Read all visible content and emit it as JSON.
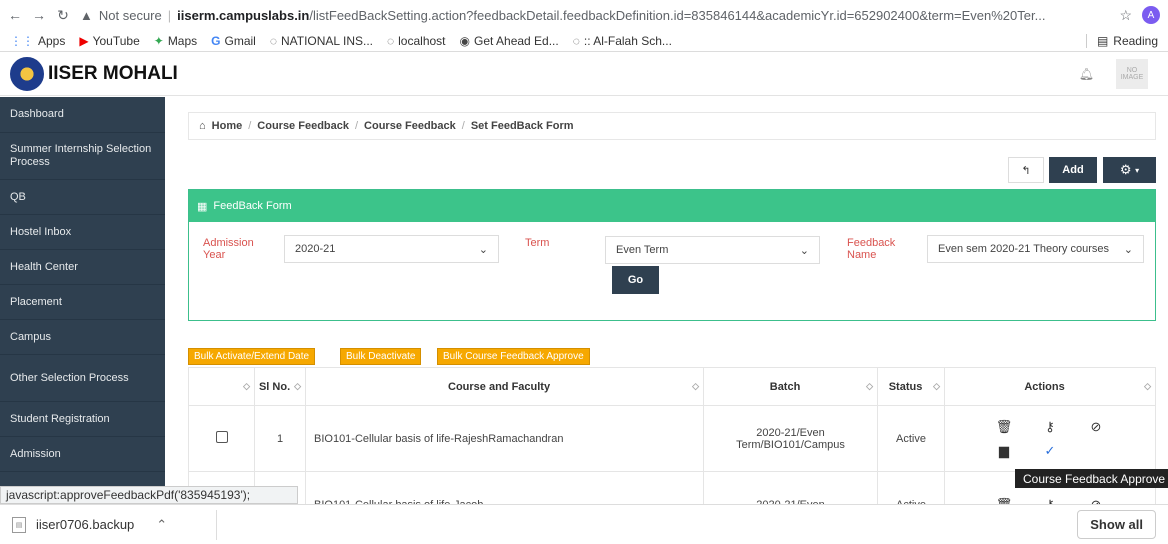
{
  "browser": {
    "security": "Not secure",
    "host": "iiserm.campuslabs.in",
    "path": "/listFeedBackSetting.action?feedbackDetail.feedbackDefinition.id=835846144&academicYr.id=652902400&term=Even%20Ter...",
    "avatar_letter": "A",
    "bookmarks": [
      "Apps",
      "YouTube",
      "Maps",
      "Gmail",
      "NATIONAL INS...",
      "localhost",
      "Get Ahead Ed...",
      ":: Al-Falah Sch..."
    ],
    "reading_list": "Reading"
  },
  "header": {
    "brand": "IISER MOHALI",
    "profile_placeholder": "NO IMAGE"
  },
  "sidebar": {
    "items": [
      "Dashboard",
      "Summer Internship Selection Process",
      "QB",
      "Hostel Inbox",
      "Health Center",
      "Placement",
      "Campus",
      "Other Selection Process",
      "Student Registration",
      "Admission"
    ]
  },
  "breadcrumb": {
    "home": "Home",
    "items": [
      "Course Feedback",
      "Course Feedback",
      "Set FeedBack Form"
    ]
  },
  "toolbar": {
    "add_label": "Add"
  },
  "feedback_form": {
    "title": "FeedBack Form",
    "admission_year_label": "Admission Year",
    "admission_year_value": "2020-21",
    "term_label": "Term",
    "term_value": "Even Term",
    "feedback_name_label": "Feedback Name",
    "feedback_name_value": "Even sem 2020-21 Theory courses",
    "go_label": "Go"
  },
  "bulk_actions": [
    "Bulk Activate/Extend Date",
    "Bulk Deactivate",
    "Bulk Course Feedback Approve"
  ],
  "table": {
    "headers": [
      "Sl No.",
      "Course and Faculty",
      "Batch",
      "Status",
      "Actions"
    ],
    "rows": [
      {
        "sl": "1",
        "course": "BIO101-Cellular basis of life-RajeshRamachandran",
        "batch": "2020-21/Even Term/BIO101/Campus",
        "status": "Active"
      },
      {
        "sl": "2",
        "course": "BIO101-Cellular basis of life-Jacob...",
        "batch": "2020-21/Even",
        "status": "Active"
      }
    ]
  },
  "tooltip": "Course Feedback Approve",
  "status_url": "javascript:approveFeedbackPdf('835945193');",
  "download": {
    "filename": "iiser0706.backup",
    "show_all": "Show all"
  }
}
